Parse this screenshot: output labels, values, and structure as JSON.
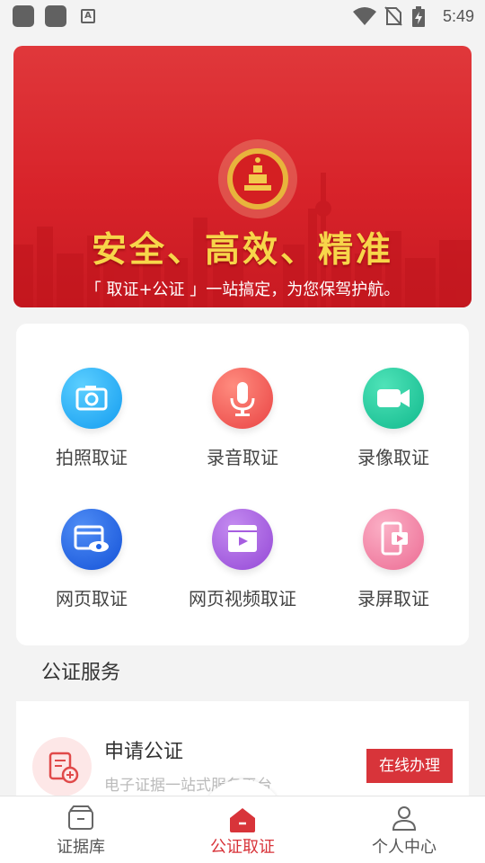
{
  "status_bar": {
    "time": "5:49",
    "icons": [
      "app-square-icon",
      "app-square-icon",
      "a-box-icon",
      "wifi-icon",
      "no-sim-icon",
      "battery-charging-icon"
    ]
  },
  "banner": {
    "title": "安全、高效、精准",
    "subtitle": "「 取证+公证 」一站搞定，为您保驾护航。",
    "page_count": 2,
    "active_index": 0
  },
  "grid": {
    "items": [
      {
        "label": "拍照取证",
        "icon": "camera-icon",
        "color": "#1fa6f5"
      },
      {
        "label": "录音取证",
        "icon": "microphone-icon",
        "color": "#f0504f"
      },
      {
        "label": "录像取证",
        "icon": "video-camera-icon",
        "color": "#18c49a"
      },
      {
        "label": "网页取证",
        "icon": "webpage-eye-icon",
        "color": "#1d63e8"
      },
      {
        "label": "网页视频取证",
        "icon": "web-video-icon",
        "color": "#a65de0"
      },
      {
        "label": "录屏取证",
        "icon": "phone-record-icon",
        "color": "#ef7b9f"
      }
    ]
  },
  "services": {
    "section_title": "公证服务",
    "items": [
      {
        "title": "申请公证",
        "description": "电子证据一站式服务平台",
        "action": "在线办理",
        "icon": "document-add-icon"
      }
    ]
  },
  "bottom_nav": {
    "items": [
      {
        "label": "证据库",
        "icon": "archive-box-icon"
      },
      {
        "label": "公证取证",
        "icon": "home-icon",
        "active": true
      },
      {
        "label": "个人中心",
        "icon": "user-icon"
      }
    ]
  },
  "colors": {
    "accent": "#d8343a",
    "banner_red": "#d8232a",
    "banner_title": "#f7d64a"
  }
}
